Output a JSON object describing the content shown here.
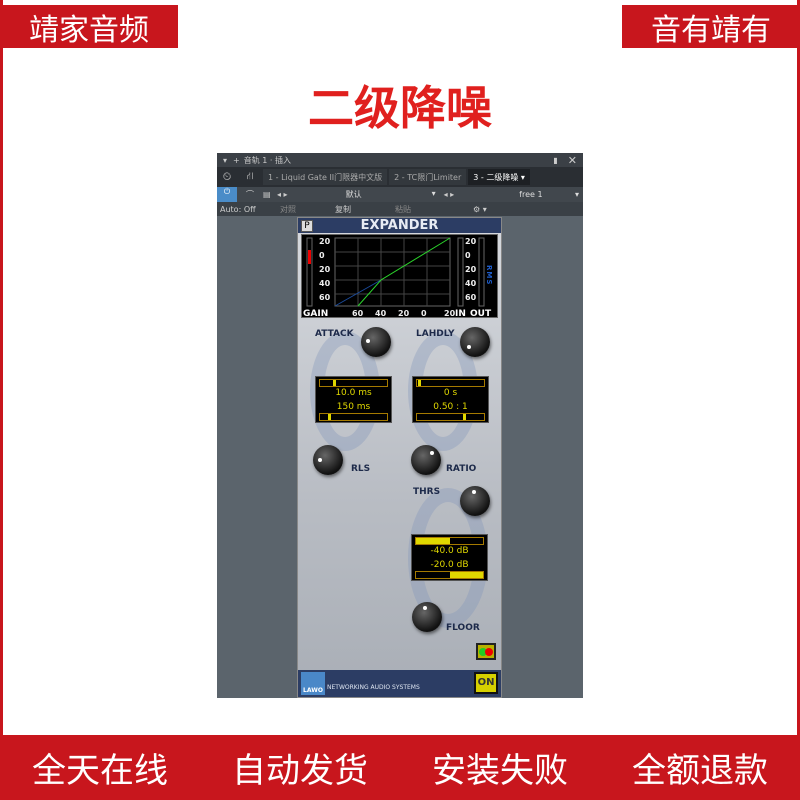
{
  "banner": {
    "top_left": "靖家音频",
    "top_right": "音有靖有",
    "title": "二级降噪",
    "bottom": [
      "全天在线",
      "自动发货",
      "安装失败",
      "全额退款"
    ]
  },
  "host": {
    "title": "音轨 1 · 插入",
    "tabs": [
      "1 - Liquid Gate II门限器中文版",
      "2 - TC限门Limiter",
      "3 - 二级降噪"
    ],
    "active_tab": 2,
    "preset": "默认",
    "preset2": "free 1",
    "auto": "Auto: Off",
    "compare": "对照",
    "copy": "复制",
    "paste": "粘贴"
  },
  "plugin": {
    "name": "EXPANDER",
    "p_button": "P",
    "graph": {
      "left_ticks": [
        "20",
        "0",
        "20",
        "40",
        "60"
      ],
      "bottom_ticks": [
        "60",
        "40",
        "20",
        "0",
        "20"
      ],
      "gain": "GAIN",
      "in": "IN",
      "out": "OUT",
      "rms": "RMS"
    },
    "attack": {
      "label": "ATTACK",
      "value": "10.0 ms",
      "slider": 0.2
    },
    "release": {
      "label": "RLS",
      "value": "150 ms",
      "slider": 0.12
    },
    "lahdly": {
      "label": "LAHDLY",
      "value": "0 s",
      "slider": 0.02
    },
    "ratio": {
      "label": "RATIO",
      "value": "0.50 : 1",
      "slider": 0.7
    },
    "threshold": {
      "label": "THRS",
      "value": "-40.0 dB",
      "slider": 0.5
    },
    "floor": {
      "label": "FLOOR",
      "value": "-20.0 dB",
      "slider": 0.5
    },
    "footer": "NETWORKING AUDIO SYSTEMS",
    "logo": "LAWO",
    "on": "ON"
  },
  "colors": {
    "red": "#c8161d",
    "lcd": "#e0d800",
    "header": "#2c3d64"
  }
}
